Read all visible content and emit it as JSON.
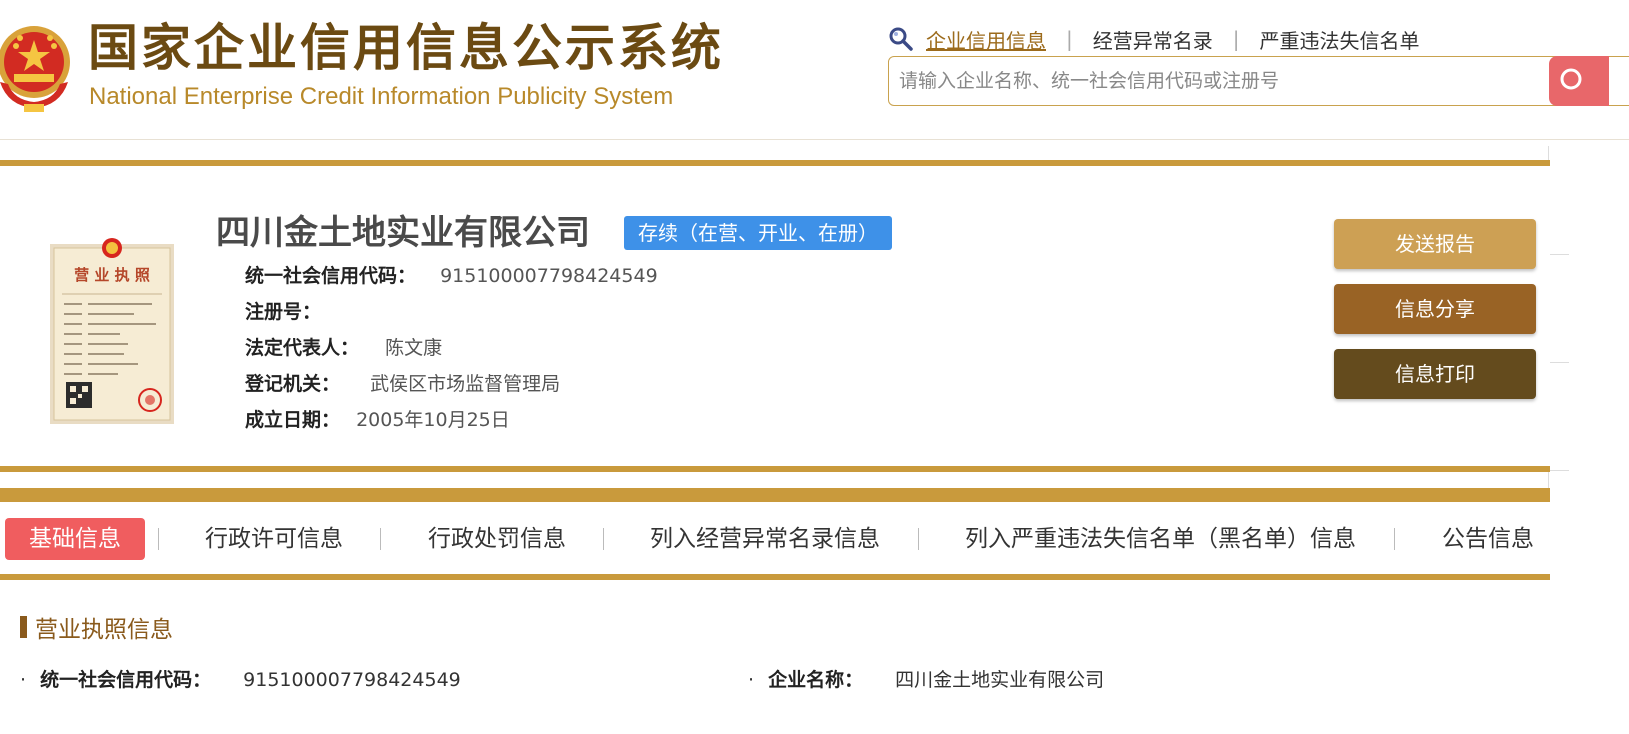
{
  "header": {
    "logo_cn": "国家企业信用信息公示系统",
    "logo_en": "National Enterprise Credit Information Publicity System",
    "nav": {
      "credit_info": "企业信用信息",
      "abnormal_list": "经营异常名录",
      "blacklist": "严重违法失信名单"
    },
    "search": {
      "placeholder": "请输入企业名称、统一社会信用代码或注册号"
    }
  },
  "company": {
    "name": "四川金土地实业有限公司",
    "status": "存续（在营、开业、在册）",
    "credit_code_label": "统一社会信用代码：",
    "credit_code": "915100007798424549",
    "reg_no_label": "注册号：",
    "reg_no": "",
    "legal_rep_label": "法定代表人：",
    "legal_rep": "陈文康",
    "authority_label": "登记机关：",
    "authority": "武侯区市场监督管理局",
    "founded_label": "成立日期：",
    "founded": "2005年10月25日"
  },
  "license_image": {
    "title": "营 业 执 照"
  },
  "actions": {
    "send_report": "发送报告",
    "share": "信息分享",
    "print": "信息打印"
  },
  "tabs": [
    {
      "label": "基础信息",
      "active": true
    },
    {
      "label": "行政许可信息"
    },
    {
      "label": "行政处罚信息"
    },
    {
      "label": "列入经营异常名录信息"
    },
    {
      "label": "列入严重违法失信名单（黑名单）信息"
    },
    {
      "label": "公告信息"
    }
  ],
  "section": {
    "title": "营业执照信息",
    "fields": [
      {
        "label": "统一社会信用代码：",
        "value": "915100007798424549"
      },
      {
        "label": "企业名称：",
        "value": "四川金土地实业有限公司"
      }
    ]
  },
  "colors": {
    "gold": "#c99a3c",
    "brown_dark": "#6b4a12",
    "status_blue": "#3e91e8",
    "tab_active": "#f05d5f"
  }
}
